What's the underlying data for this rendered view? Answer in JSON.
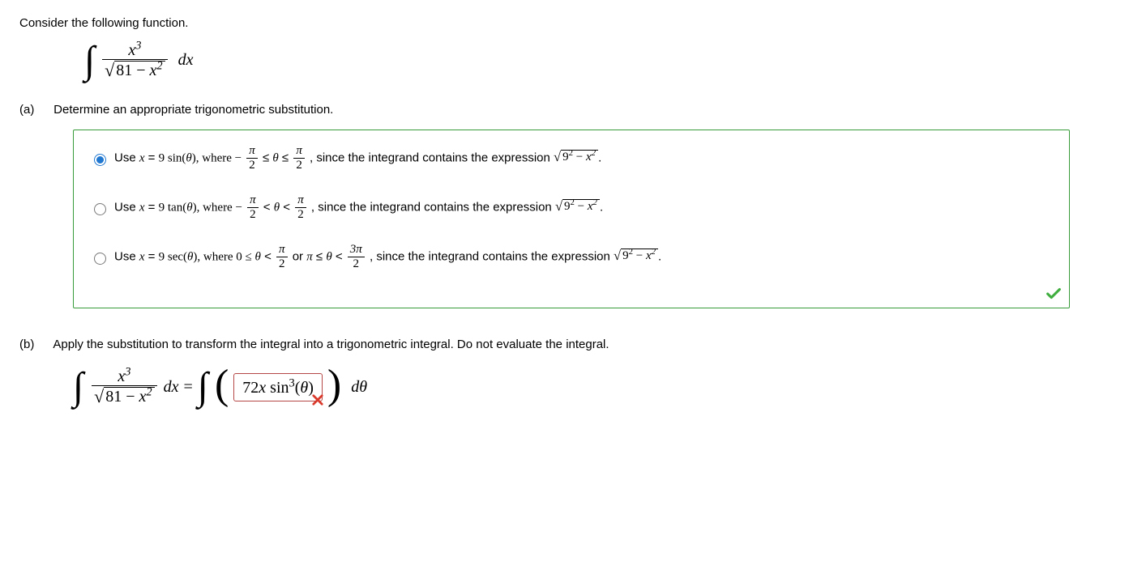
{
  "prompt": "Consider the following function.",
  "integral_display": {
    "numerator_sup": "3",
    "radicand_a": "81",
    "radicand_b_sup": "2",
    "dx": "dx"
  },
  "part_a": {
    "label": "(a)",
    "text": "Determine an appropriate trigonometric substitution."
  },
  "options": [
    {
      "prefix": "Use ",
      "eq_lhs_var": "x",
      "eq_rhs_coef": "9 sin(",
      "theta": "θ",
      "eq_rhs_close": "), where −",
      "range_pi": "π",
      "range_two": "2",
      "cmp1": " ≤ ",
      "mid_theta": "θ",
      "cmp2": " ≤ ",
      "since": ", since the integrand contains the expression ",
      "surd_a": "9",
      "surd_a_sup": "2",
      "minus": " − ",
      "surd_b": "x",
      "surd_b_sup": "2",
      "period": "."
    },
    {
      "prefix": "Use ",
      "eq_lhs_var": "x",
      "eq_rhs_coef": "9 tan(",
      "theta": "θ",
      "eq_rhs_close": "), where −",
      "range_pi": "π",
      "range_two": "2",
      "cmp1": " < ",
      "mid_theta": "θ",
      "cmp2": " < ",
      "since": ", since the integrand contains the expression ",
      "surd_a": "9",
      "surd_a_sup": "2",
      "minus": " − ",
      "surd_b": "x",
      "surd_b_sup": "2",
      "period": "."
    },
    {
      "prefix": "Use ",
      "eq_lhs_var": "x",
      "eq_rhs_coef": "9 sec(",
      "theta": "θ",
      "eq_rhs_close": "), where 0 ≤ ",
      "mid_theta1": "θ",
      "cmp1": " < ",
      "range_pi": "π",
      "range_two": "2",
      "or_text": " or ",
      "pi_sym": "π",
      "cmp2": " ≤ ",
      "mid_theta2": "θ",
      "cmp3": " < ",
      "range2_num": "3π",
      "range2_den": "2",
      "since": ", since the integrand contains the expression ",
      "surd_a": "9",
      "surd_a_sup": "2",
      "minus": " − ",
      "surd_b": "x",
      "surd_b_sup": "2",
      "period": "."
    }
  ],
  "selected_option": 0,
  "feedback_a": "correct",
  "part_b": {
    "label": "(b)",
    "text": "Apply the substitution to transform the integral into a trigonometric integral. Do not evaluate the integral.",
    "answer_value": "72x sin³(θ)",
    "answer_prefix_coef": "72",
    "answer_var": "x",
    "answer_func": " sin",
    "answer_sup": "3",
    "answer_arg_open": "(",
    "answer_theta": "θ",
    "answer_arg_close": ")",
    "d_theta": "dθ",
    "feedback": "incorrect"
  },
  "symbols": {
    "integral": "∫",
    "surd": "√",
    "x_var": "x",
    "minus": " − ",
    "equals": " = ",
    "dx": "dx"
  }
}
